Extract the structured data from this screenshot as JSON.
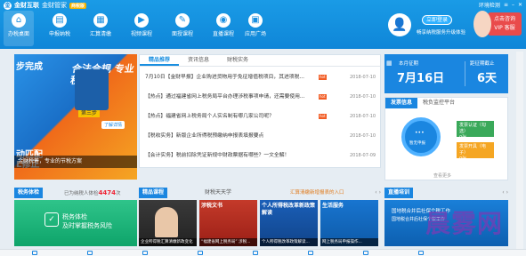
{
  "header": {
    "app_name": "金财互联",
    "sub_name": "金财管家",
    "badge": "商税版",
    "env_check": "环境检测",
    "login_label": "立即登录",
    "login_tip": "畅享纳税服务升级体验",
    "vip_label1": "点击咨询",
    "vip_label2": "VIP 客服",
    "nav": [
      {
        "label": "办税桌面",
        "icon": "home-icon",
        "glyph": "⌂"
      },
      {
        "label": "申报纳税",
        "icon": "declare-icon",
        "glyph": "▤"
      },
      {
        "label": "汇算清缴",
        "icon": "settle-icon",
        "glyph": "▦"
      },
      {
        "label": "视频课程",
        "icon": "video-icon",
        "glyph": "▶"
      },
      {
        "label": "面授课程",
        "icon": "classroom-icon",
        "glyph": "✎"
      },
      {
        "label": "直播课程",
        "icon": "live-icon",
        "glyph": "◉"
      },
      {
        "label": "应用广场",
        "icon": "apps-icon",
        "glyph": "▣"
      }
    ]
  },
  "banner": {
    "heading": "步完成",
    "slogan": "合法合规 专业税筹",
    "step": "第三步",
    "bottom_text1": "动匹配",
    "bottom_text2": "L修正",
    "learn_more": "了解详情",
    "caption": "金财税筹，专业的节税方案"
  },
  "news": {
    "tabs": [
      "精品推荐",
      "资讯信息",
      "财税实务"
    ],
    "items": [
      {
        "title": "7月10日【金财早报】企业购进货物用于免征增值税项目，其进项税...",
        "hot": "hot",
        "date": "2018-07-10"
      },
      {
        "title": "【热点】通过福建省网上税务局平台办理涉税事项申请，还需要使用...",
        "hot": "hot",
        "date": "2018-07-10"
      },
      {
        "title": "【热点】福建省网上税务局个人实名制有哪几家公司呢？",
        "hot": "hot",
        "date": "2018-07-10"
      },
      {
        "title": "【税收实务】新版企业所得税预缴纳申报表填报要点",
        "hot": "",
        "date": "2018-07-10"
      },
      {
        "title": "【会计实务】税前扣除凭证新规中财政票据有哪些？一文全解！",
        "hot": "",
        "date": "2018-07-09"
      }
    ]
  },
  "calendar": {
    "month_label": "本月征期",
    "date": "7月16日",
    "remain_label": "距征期截止",
    "remain": "6天"
  },
  "tax_panel": {
    "tabs": [
      "发票信息",
      "税负监控平台"
    ],
    "circle_label": "暂无申报",
    "card1": "发票认证（勾选）",
    "card1_sub": "0张",
    "card2": "发票开具（电子）",
    "card2_sub": "0张",
    "more": "查看更多"
  },
  "sections": {
    "tax_check": "税务体检",
    "tax_check_info_pre": "已为纳税人体检",
    "tax_check_count": "4474",
    "tax_check_info_post": "次",
    "courses": "精品课程",
    "courses_tab2": "财税天天学",
    "courses_tab3": "汇算清缴新增报表的入口",
    "training": "直播培训",
    "arrows": "‹ ›"
  },
  "tax_check_card": {
    "line1": "税务体检",
    "line2": "及时掌握税务风险"
  },
  "course_cards": [
    {
      "title": "",
      "caption": "企业所得税汇算清缴新政变化"
    },
    {
      "title": "涉税文书",
      "caption": "“福建省网上税务局” 涉税..."
    },
    {
      "title": "个人所得税改革新政策解读",
      "caption": "个人所得税改革政策解读..."
    },
    {
      "title": "生活服务",
      "caption": "网上税务局申报操作..."
    }
  ],
  "training_card": {
    "line1": "国地税合并后社保个税工作",
    "line2": "国地税合并后社保个税工作"
  },
  "watermark": "晨雾网",
  "colors": {
    "brand": "#1a86e0",
    "hot": "#f25c24",
    "accent": "#e94b4b"
  }
}
